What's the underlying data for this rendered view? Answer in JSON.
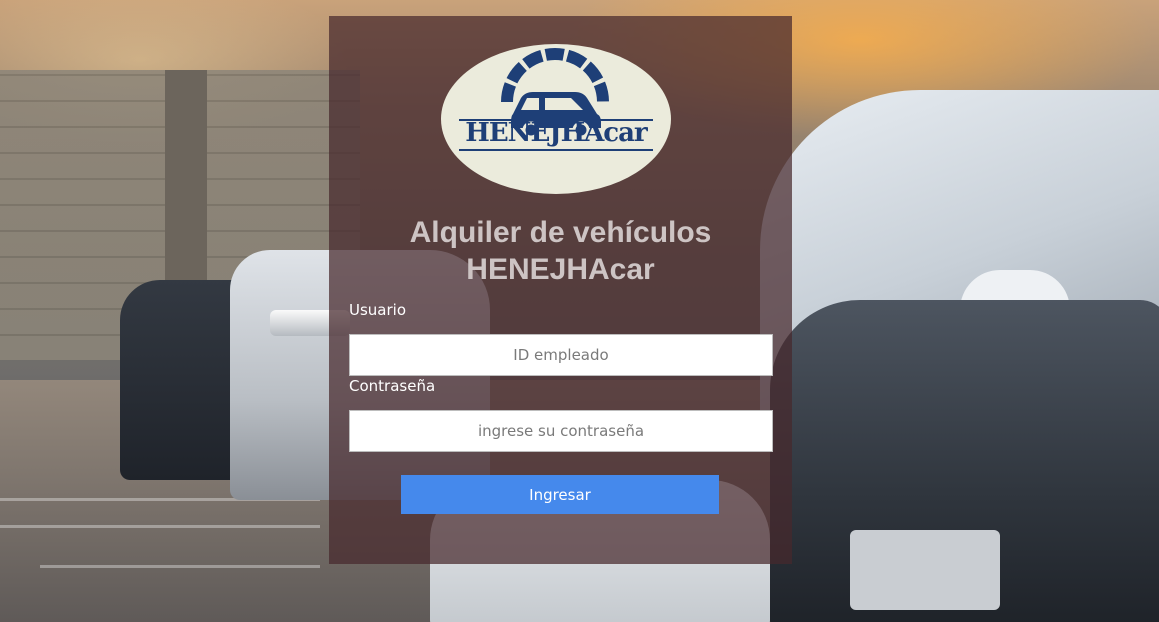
{
  "brand": {
    "logo_text": "HENEJHAcar",
    "logo_colors": {
      "background": "#ebebdc",
      "primary": "#1e3f77"
    },
    "logo_icon": "car-speedometer-icon"
  },
  "page": {
    "title_line1": "Alquiler de vehículos",
    "title_line2": "HENEJHAcar"
  },
  "form": {
    "username_label": "Usuario",
    "username_placeholder": "ID empleado",
    "username_value": "",
    "password_label": "Contraseña",
    "password_placeholder": "ingrese su contraseña",
    "password_value": "",
    "submit_label": "Ingresar"
  },
  "colors": {
    "panel_overlay": "rgba(70, 40, 44, 0.72)",
    "title_text": "#cdc4c4",
    "button": "#4589ec"
  }
}
